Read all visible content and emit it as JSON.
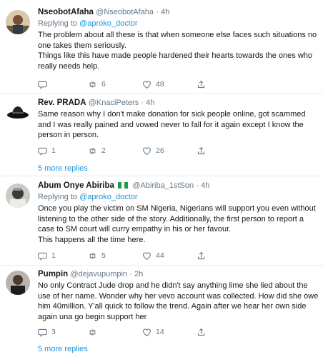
{
  "tweets": [
    {
      "name": "NseobotAfaha",
      "handle": "@NseobotAfaha",
      "separator": "·",
      "time": "4h",
      "replying_prefix": "Replying to ",
      "replying_to": "@aproko_doctor",
      "lines": [
        "The problem about all these is that when someone else faces such situations no one takes them seriously.",
        "Things like this have made people hardened their hearts towards the ones who really needs help."
      ],
      "reply_count": "",
      "retweet_count": "6",
      "like_count": "48"
    },
    {
      "name": "Rev. PRADA",
      "handle": "@KnaciPeters",
      "separator": "·",
      "time": "4h",
      "lines": [
        "Same reason why I don't make donation for sick people online, got scammed and I was really pained and vowed never to fall for it again except I know the person in person."
      ],
      "reply_count": "1",
      "retweet_count": "2",
      "like_count": "26"
    },
    {
      "name": "Abum Onye Abiriba",
      "handle": "@Abiriba_1stSon",
      "separator": "·",
      "time": "4h",
      "replying_prefix": "Replying to ",
      "replying_to": "@aproko_doctor",
      "lines": [
        "Once you play the victim on SM Nigeria, Nigerians will support you even without listening to the other side of the story. Additionally, the first person to report a case to SM court will curry empathy in his or her favour.",
        "This happens all the time here."
      ],
      "reply_count": "1",
      "retweet_count": "5",
      "like_count": "44"
    },
    {
      "name": "Pumpin",
      "handle": "@dejavupumpin",
      "separator": "·",
      "time": "2h",
      "lines": [
        "No only Contract Jude drop and he didn't say anything lime she lied about the use of her name. Wonder why her vevo account was collected. How did she owe him 40million. Y'all quick to follow the trend. Again after we hear her own side again una go begin support her"
      ],
      "reply_count": "3",
      "retweet_count": "",
      "like_count": "14"
    }
  ],
  "more_replies_label": "5 more replies",
  "colors": {
    "link": "#1b95e0",
    "muted": "#657786",
    "text": "#14171a",
    "divider": "#e6ecf0"
  },
  "icons": [
    "reply-icon",
    "retweet-icon",
    "like-icon",
    "share-icon",
    "nigeria-flag-icon"
  ]
}
